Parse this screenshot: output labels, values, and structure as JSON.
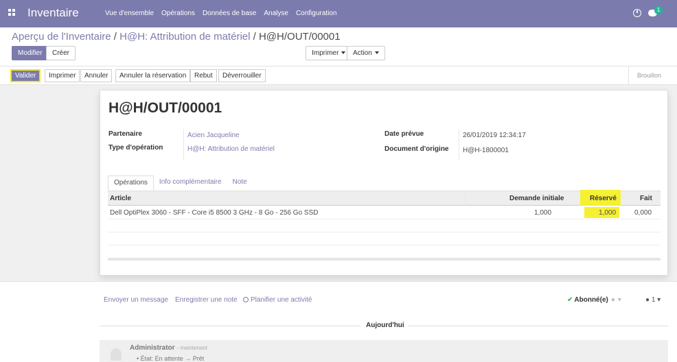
{
  "navbar": {
    "app_name": "Inventaire",
    "menu": [
      "Vue d'ensemble",
      "Opérations",
      "Données de base",
      "Analyse",
      "Configuration"
    ],
    "notification_count": "1"
  },
  "breadcrumb": {
    "root": "Aperçu de l'Inventaire",
    "middle": "H@H: Attribution de matériel",
    "current": "H@H/OUT/00001",
    "separator": " / "
  },
  "toolbar": {
    "edit": "Modifier",
    "create": "Créer",
    "print": "Imprimer",
    "action": "Action"
  },
  "statusbar": {
    "buttons": [
      "Valider",
      "Imprimer",
      "Annuler",
      "Annuler la réservation",
      "Rebut",
      "Déverrouiller"
    ],
    "state": "Brouillon"
  },
  "record": {
    "name": "H@H/OUT/00001",
    "partner_label": "Partenaire",
    "partner_value": "Acien Jacqueline",
    "optype_label": "Type d'opération",
    "optype_value": "H@H: Attribution de matériel",
    "date_label": "Date prévue",
    "date_value": "26/01/2019 12:34:17",
    "origin_label": "Document d'origine",
    "origin_value": "H@H-1800001"
  },
  "tabs": [
    "Opérations",
    "Info complémentaire",
    "Note"
  ],
  "table": {
    "headers": [
      "Article",
      "Demande initiale",
      "Réservé",
      "Fait"
    ],
    "rows": [
      {
        "article": "Dell OptiPlex 3060 - SFF - Core i5 8500 3 GHz - 8 Go - 256 Go SSD",
        "demande": "1,000",
        "reserve": "1,000",
        "fait": "0,000"
      }
    ]
  },
  "chatter": {
    "send_message": "Envoyer un message",
    "log_note": "Enregistrer une note",
    "schedule": "Planifier une activité",
    "follow": "Abonné(e)",
    "followers_count": "1",
    "today": "Aujourd'hui",
    "author": "Administrator",
    "time": "- maintenant",
    "tracking": "• État: En attente → Prêt"
  },
  "colors": {
    "brand": "#7c7bad",
    "highlight": "#f5f032"
  }
}
